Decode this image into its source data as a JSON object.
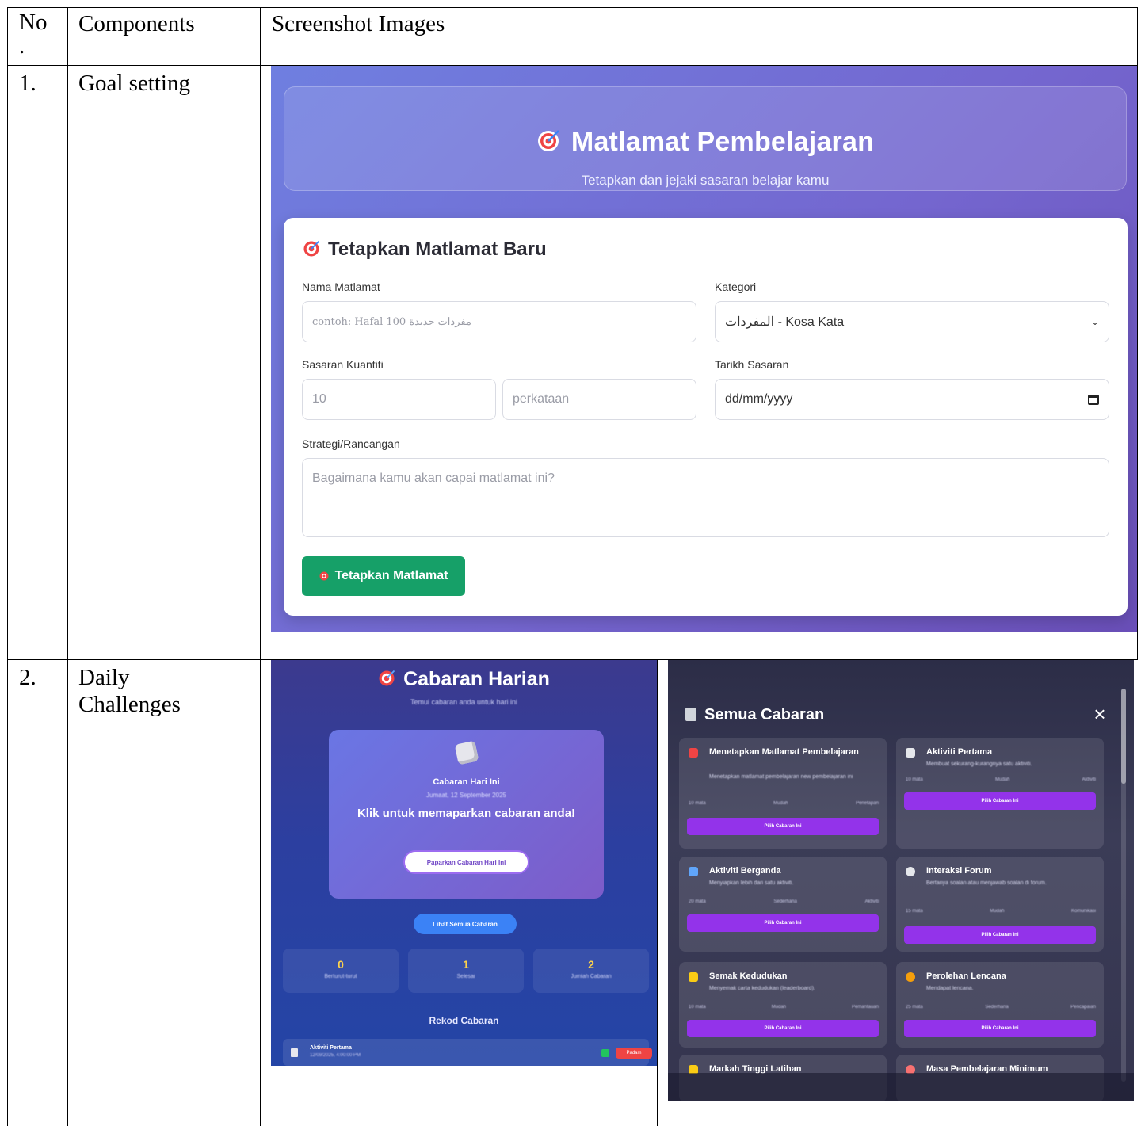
{
  "table": {
    "headers": {
      "no": "No\n.",
      "components": "Components",
      "screenshots": "Screenshot Images"
    },
    "rows": [
      {
        "no": "1.",
        "component": "Goal setting"
      },
      {
        "no": "2.",
        "component": "Daily\nChallenges"
      }
    ]
  },
  "goal_screen": {
    "title": "Matlamat Pembelajaran",
    "subtitle": "Tetapkan dan jejaki sasaran belajar kamu",
    "form_title": "Tetapkan Matlamat Baru",
    "name_label": "Nama Matlamat",
    "name_placeholder": "contoh: Hafal 100 مفردات جديدة",
    "category_label": "Kategori",
    "category_value": "المفردات - Kosa Kata",
    "quantity_label": "Sasaran Kuantiti",
    "quantity_placeholder": "10",
    "unit_placeholder": "perkataan",
    "date_label": "Tarikh Sasaran",
    "date_placeholder": "dd/mm/yyyy",
    "strategy_label": "Strategi/Rancangan",
    "strategy_placeholder": "Bagaimana kamu akan capai matlamat ini?",
    "submit_label": "Tetapkan Matlamat",
    "accent_color": "#16a068"
  },
  "daily_screen": {
    "title": "Cabaran Harian",
    "subtitle": "Temui cabaran anda untuk hari ini",
    "card_label": "Cabaran Hari Ini",
    "card_date": "Jumaat, 12 September 2025",
    "card_cta": "Klik untuk memaparkan cabaran anda!",
    "reveal_button": "Paparkan Cabaran Hari Ini",
    "all_button": "Lihat Semua Cabaran",
    "stats": [
      {
        "value": "0",
        "label": "Berturut-turut"
      },
      {
        "value": "1",
        "label": "Selesai"
      },
      {
        "value": "2",
        "label": "Jumlah Cabaran"
      }
    ],
    "history_title": "Rekod Cabaran",
    "history_item": {
      "name": "Aktiviti Pertama",
      "meta": "12/09/2025, 4:00:00 PM",
      "delete": "Padam"
    }
  },
  "modal_screen": {
    "title": "Semua Cabaran",
    "pick_button": "Pilih Cabaran Ini",
    "challenges": [
      {
        "name": "Menetapkan Matlamat Pembelajaran",
        "desc": "Menetapkan matlamat pembelajaran new pembelajaran ini",
        "meta": [
          "10 mata",
          "Mudah",
          "Penetapan"
        ]
      },
      {
        "name": "Aktiviti Pertama",
        "desc": "Membuat sekurang-kurangnya satu aktiviti.",
        "meta": [
          "10 mata",
          "Mudah",
          "Aktiviti"
        ]
      },
      {
        "name": "Aktiviti Berganda",
        "desc": "Menyiapkan lebih dari satu aktiviti.",
        "meta": [
          "20 mata",
          "Sederhana",
          "Aktiviti"
        ]
      },
      {
        "name": "Interaksi Forum",
        "desc": "Bertanya soalan atau menjawab soalan di forum.",
        "meta": [
          "15 mata",
          "Mudah",
          "Komunikasi"
        ]
      },
      {
        "name": "Semak Kedudukan",
        "desc": "Menyemak carta kedudukan (leaderboard).",
        "meta": [
          "10 mata",
          "Mudah",
          "Pemantauan"
        ]
      },
      {
        "name": "Perolehan Lencana",
        "desc": "Mendapat lencana.",
        "meta": [
          "25 mata",
          "Sederhana",
          "Pencapaian"
        ]
      },
      {
        "name": "Markah Tinggi Latihan"
      },
      {
        "name": "Masa Pembelajaran Minimum"
      }
    ],
    "icon_colors": [
      "#ef4444",
      "#e5e7eb",
      "#60a5fa",
      "#e5e7eb",
      "#facc15",
      "#f59e0b",
      "#facc15",
      "#f87171"
    ]
  }
}
